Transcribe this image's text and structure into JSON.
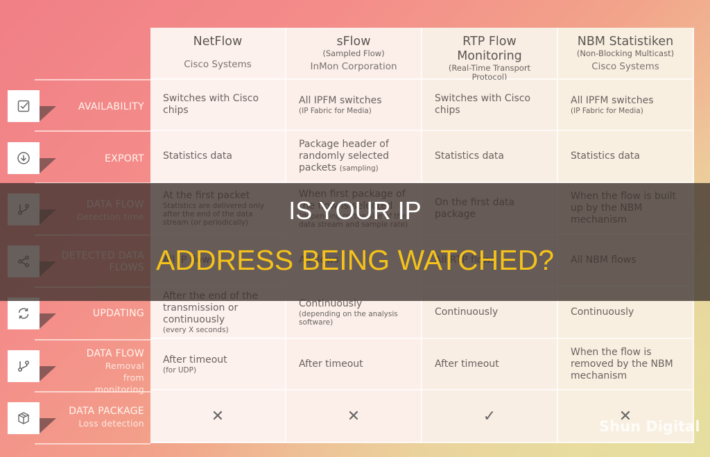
{
  "headline": {
    "line1": "IS YOUR IP",
    "line2": "ADDRESS BEING WATCHED?"
  },
  "watermark": "Shun Digital",
  "columns": [
    {
      "name": "NetFlow",
      "abbr": "",
      "vendor": "Cisco Systems"
    },
    {
      "name": "sFlow",
      "abbr": "(Sampled Flow)",
      "vendor": "InMon Corporation"
    },
    {
      "name": "RTP Flow Monitoring",
      "abbr": "(Real-Time Transport Protocol)",
      "vendor": "Cisco Systems"
    },
    {
      "name": "NBM Statistiken",
      "abbr": "(Non-Blocking Multicast)",
      "vendor": "Cisco Systems"
    }
  ],
  "rows": [
    {
      "label": "AVAILABILITY",
      "sub": "",
      "icon": "checkbox-icon",
      "cells": [
        {
          "main": "Switches with Cisco chips",
          "note": ""
        },
        {
          "main": "All IPFM switches",
          "note": "(IP Fabric for Media)"
        },
        {
          "main": "Switches with Cisco chips",
          "note": ""
        },
        {
          "main": "All IPFM switches",
          "note": "(IP Fabric for Media)"
        }
      ]
    },
    {
      "label": "EXPORT",
      "sub": "",
      "icon": "download-circle-icon",
      "cells": [
        {
          "main": "Statistics data",
          "note": ""
        },
        {
          "main": "Package header of randomly selected packets",
          "note": "(sampling)"
        },
        {
          "main": "Statistics data",
          "note": ""
        },
        {
          "main": "Statistics data",
          "note": ""
        }
      ]
    },
    {
      "label": "DATA FLOW",
      "sub": "Detection time",
      "icon": "branch-icon",
      "cells": [
        {
          "main": "At the first packet",
          "note": "Statistics are delivered only after the end of the data stream (or periodically)"
        },
        {
          "main": "When first package of the flow is selected",
          "note": "(depending on the size of the data stream and sample rate)"
        },
        {
          "main": "On the first data package",
          "note": ""
        },
        {
          "main": "When the flow is built up by the NBM mechanism",
          "note": ""
        }
      ]
    },
    {
      "label": "DETECTED DATA FLOWS",
      "sub": "",
      "icon": "share-icon",
      "cells": [
        {
          "main": "All IP flows",
          "note": ""
        },
        {
          "main": "All flows",
          "note": ""
        },
        {
          "main": "All RTP flows",
          "note": ""
        },
        {
          "main": "All NBM flows",
          "note": ""
        }
      ]
    },
    {
      "label": "UPDATING",
      "sub": "",
      "icon": "refresh-icon",
      "cells": [
        {
          "main": "After the end of the transmission or continuously",
          "note": "(every X seconds)"
        },
        {
          "main": "Continuously",
          "note": "(depending on the analysis software)"
        },
        {
          "main": "Continuously",
          "note": ""
        },
        {
          "main": "Continuously",
          "note": ""
        }
      ]
    },
    {
      "label": "DATA FLOW",
      "sub": "Removal from monitoring",
      "icon": "branch-icon",
      "cells": [
        {
          "main": "After timeout",
          "note": "(for UDP)"
        },
        {
          "main": "After timeout",
          "note": ""
        },
        {
          "main": "After timeout",
          "note": ""
        },
        {
          "main": "When the flow is removed by the NBM mechanism",
          "note": ""
        }
      ]
    },
    {
      "label": "DATA PACKAGE",
      "sub": "Loss detection",
      "icon": "package-icon",
      "marks": [
        "✕",
        "✕",
        "✓",
        "✕"
      ],
      "mark_names": [
        "cross-icon",
        "cross-icon",
        "check-icon",
        "cross-icon"
      ]
    }
  ]
}
